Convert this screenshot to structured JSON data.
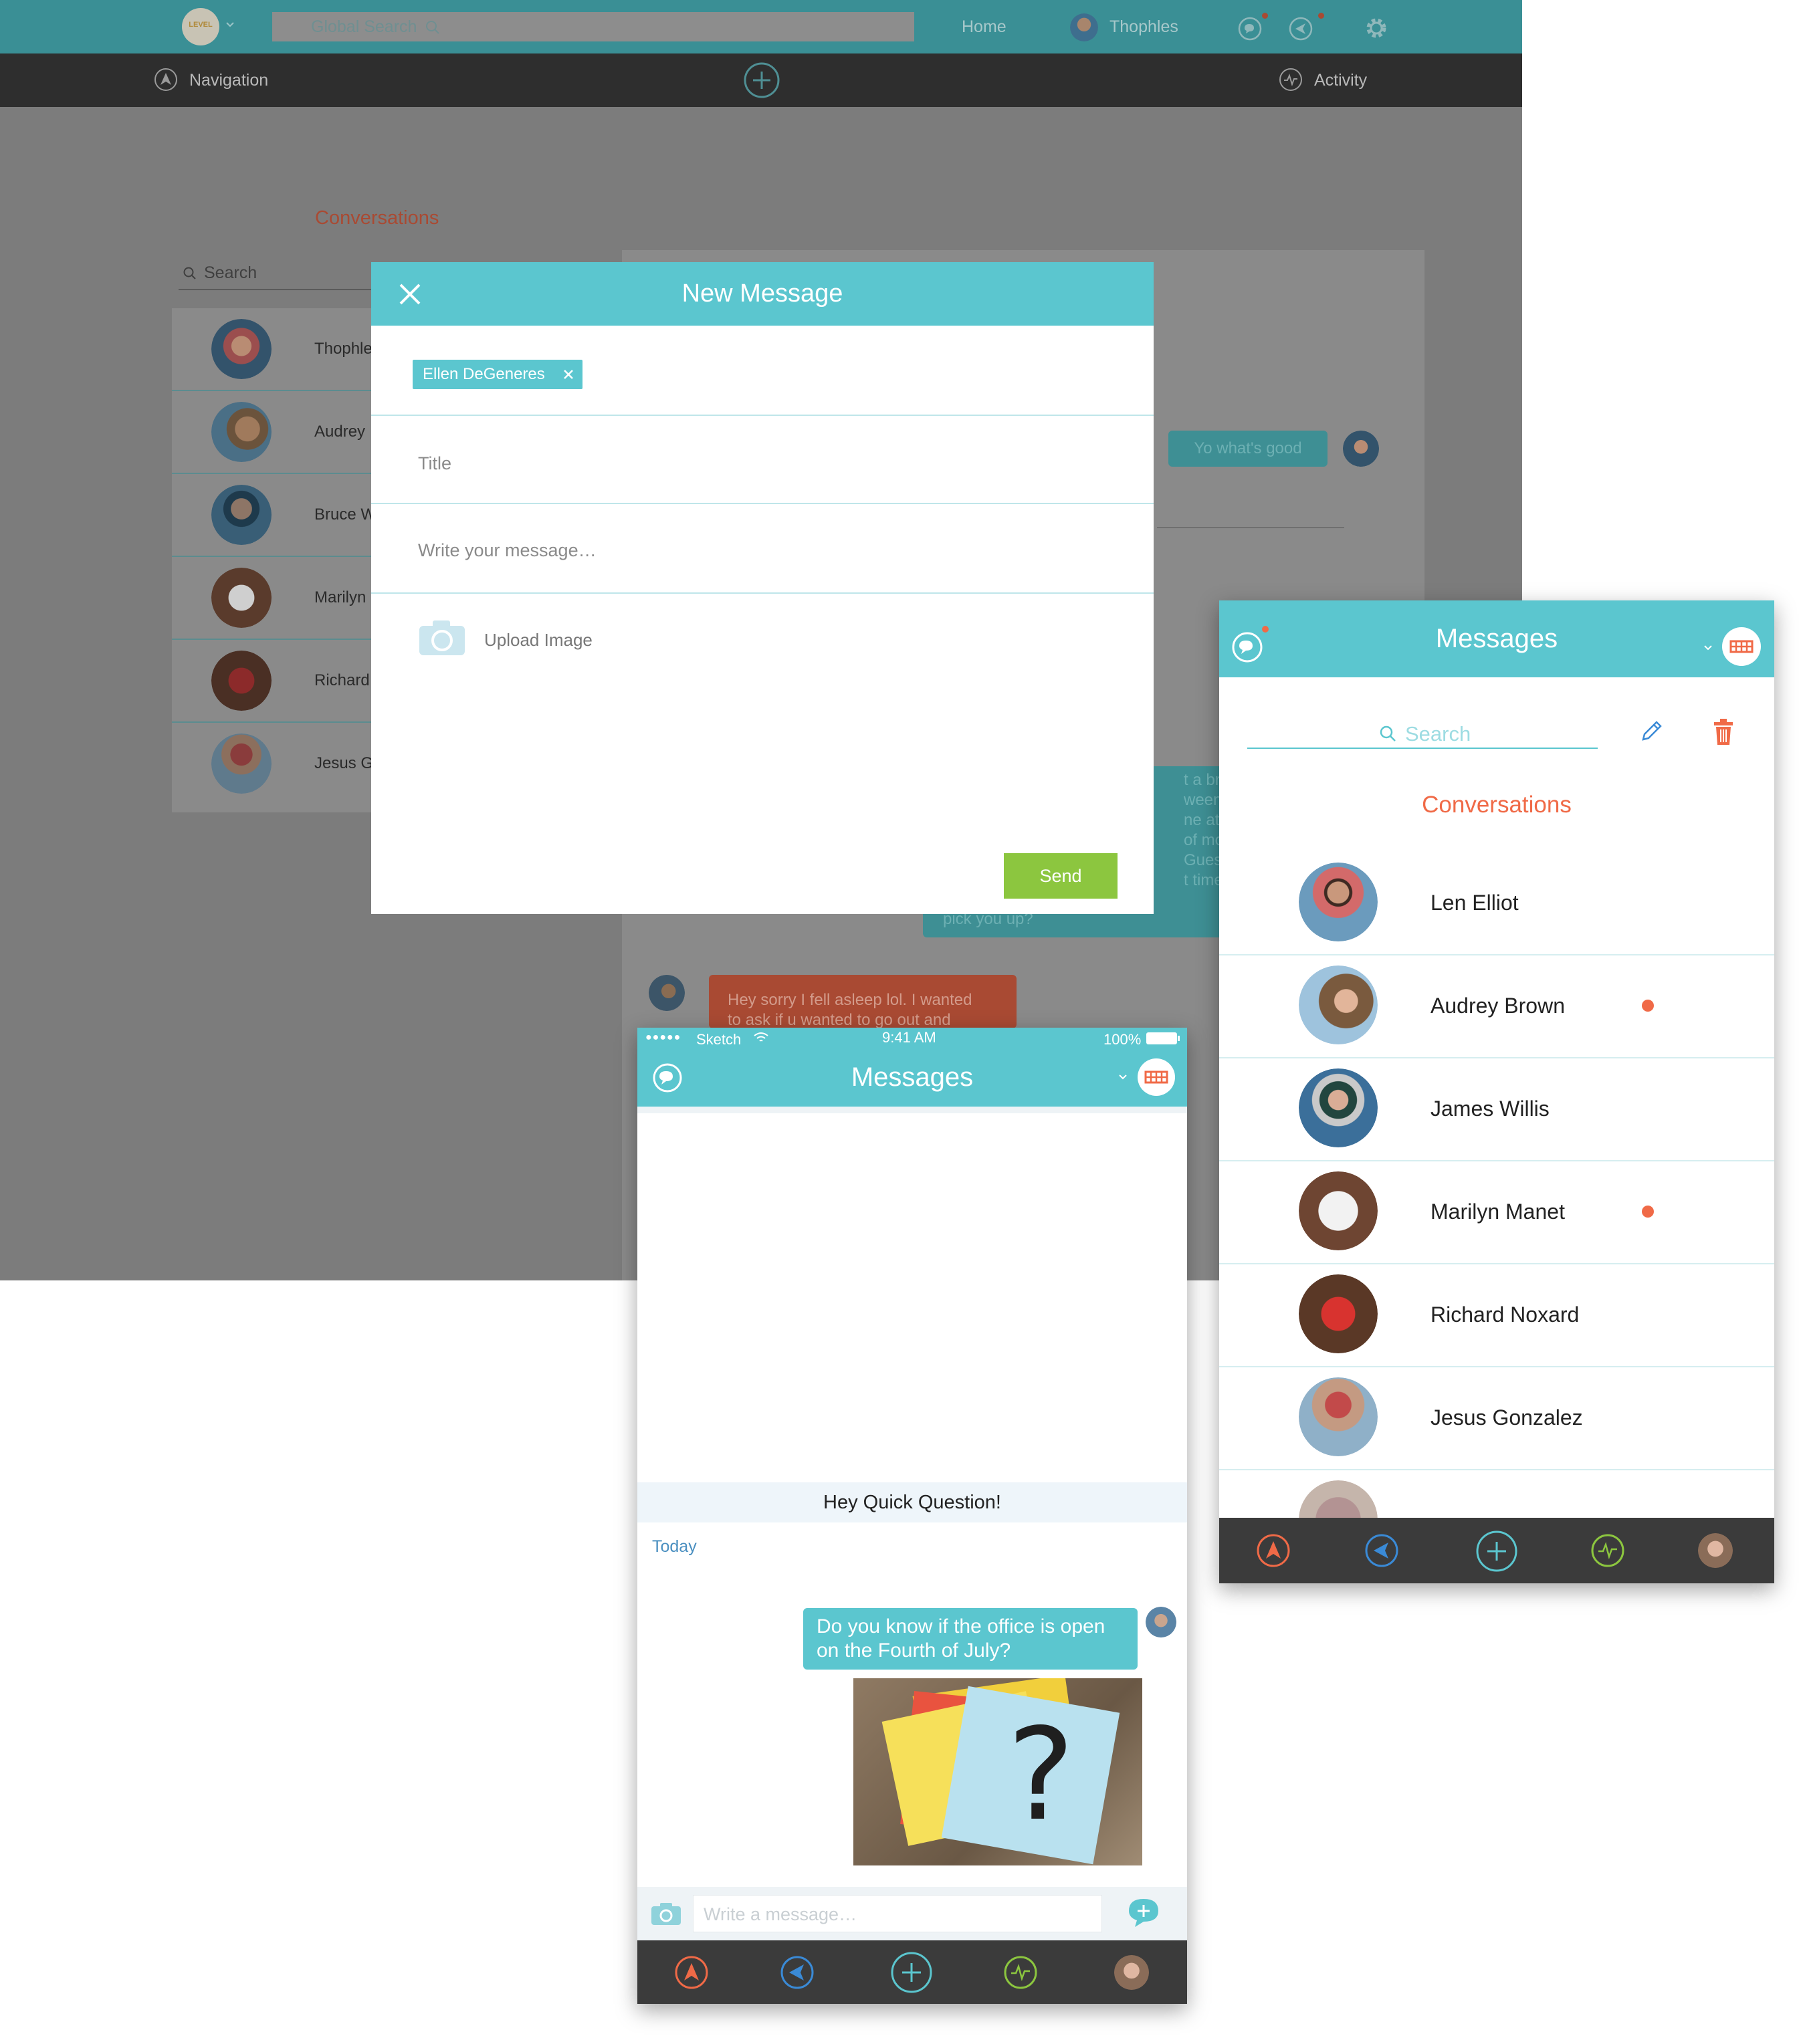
{
  "desktop": {
    "topbar": {
      "logo_text": "LEVEL",
      "search_placeholder": "Global Search",
      "home_label": "Home",
      "user_name": "Thophles"
    },
    "navbar": {
      "navigation_label": "Navigation",
      "activity_label": "Activity"
    },
    "conversations_title": "Conversations",
    "search_placeholder": "Search",
    "conversations": [
      {
        "name": "Thophles"
      },
      {
        "name": "Audrey"
      },
      {
        "name": "Bruce W"
      },
      {
        "name": "Marilyn"
      },
      {
        "name": "Richard"
      },
      {
        "name": "Jesus G"
      }
    ],
    "chat": {
      "incoming_bubble": "Yo what's good",
      "teal_bubble_lines": [
        "t a broke",
        "ween job",
        "ne at nig",
        "of money",
        "Guess",
        "t time yo",
        "pick you up?"
      ],
      "red_bubble_lines": [
        "Hey sorry I fell asleep lol. I wanted",
        "to ask if u wanted to go out and"
      ]
    }
  },
  "modal": {
    "title": "New Message",
    "recipient": "Ellen DeGeneres",
    "title_placeholder": "Title",
    "message_placeholder": "Write your message…",
    "upload_label": "Upload Image",
    "send_label": "Send"
  },
  "mobile_list": {
    "title": "Messages",
    "search_placeholder": "Search",
    "section_title": "Conversations",
    "conversations": [
      {
        "name": "Len Elliot",
        "unread": false
      },
      {
        "name": "Audrey Brown",
        "unread": true
      },
      {
        "name": "James Willis",
        "unread": false
      },
      {
        "name": "Marilyn Manet",
        "unread": true
      },
      {
        "name": "Richard Noxard",
        "unread": false
      },
      {
        "name": "Jesus Gonzalez",
        "unread": false
      }
    ]
  },
  "mobile_chat": {
    "status": {
      "carrier": "Sketch",
      "time": "9:41 AM",
      "battery": "100%"
    },
    "title": "Messages",
    "subject": "Hey Quick Question!",
    "date_label": "Today",
    "outgoing_message": "Do you know if the office is open on the Fourth of July?",
    "image_caption": "?",
    "input_placeholder": "Write a message…"
  },
  "colors": {
    "accent": "#5bc6cf",
    "send": "#8cc63f",
    "alert": "#f06a47",
    "tabbar": "#3b3b3b"
  }
}
